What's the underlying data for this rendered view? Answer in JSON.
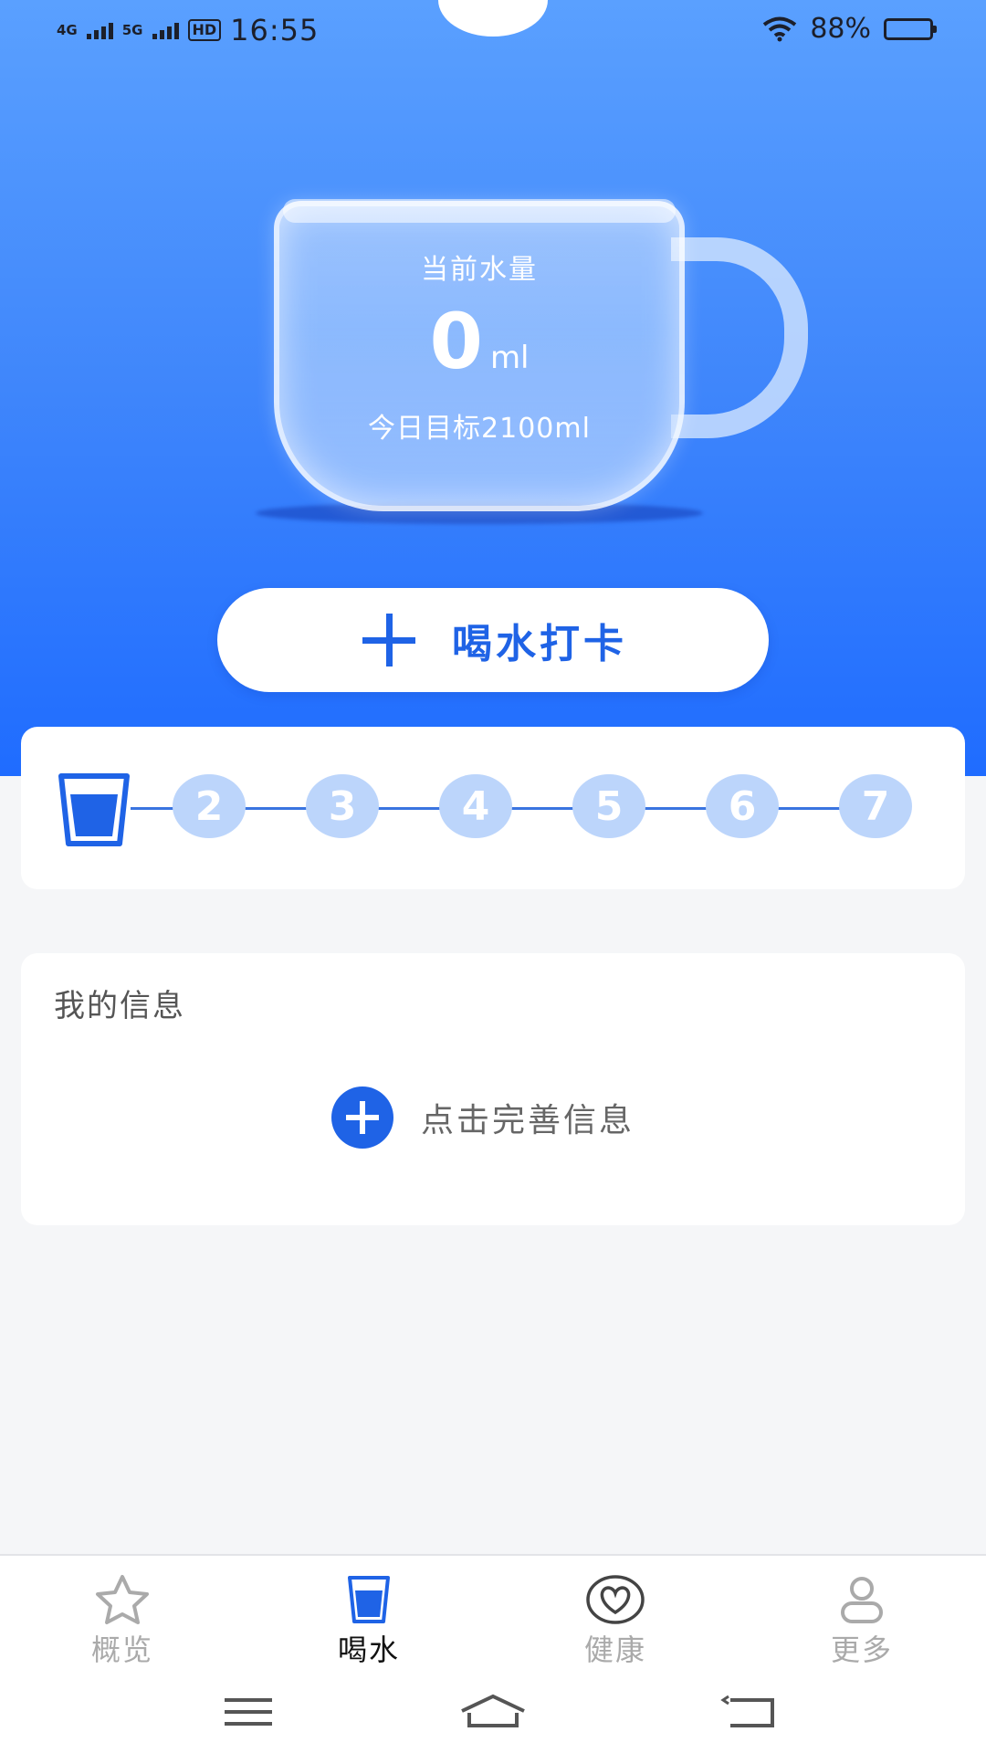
{
  "status_bar": {
    "network1": "4G",
    "network2": "5G",
    "hd": "HD",
    "time": "16:55",
    "battery": "88%",
    "battery_level": 0.88
  },
  "cup": {
    "label": "当前水量",
    "amount": "0",
    "unit": "ml",
    "goal": "今日目标2100ml"
  },
  "checkin": {
    "label": "喝水打卡",
    "icon": "plus-icon"
  },
  "progress": {
    "current_icon": "water-glass-icon",
    "steps": [
      "2",
      "3",
      "4",
      "5",
      "6",
      "7"
    ]
  },
  "info": {
    "title": "我的信息",
    "action": "点击完善信息",
    "icon": "plus-circle-icon"
  },
  "tabs": [
    {
      "label": "概览",
      "icon": "star-icon",
      "active": false
    },
    {
      "label": "喝水",
      "icon": "water-glass-icon",
      "active": true
    },
    {
      "label": "健康",
      "icon": "heart-icon",
      "active": false
    },
    {
      "label": "更多",
      "icon": "user-icon",
      "active": false
    }
  ],
  "colors": {
    "primary": "#1f63e6",
    "hero_top": "#5aa0ff",
    "hero_bottom": "#1f6cff",
    "step_inactive": "#bcd5fb"
  }
}
